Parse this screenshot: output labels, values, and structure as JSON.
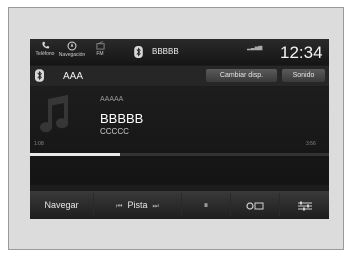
{
  "status_bar": {
    "phone_label": "Teléfono",
    "navigation_label": "Navegación",
    "radio_label": "FM",
    "device_name": "BBBBB",
    "clock": "12:34"
  },
  "header": {
    "source_title": "AAA",
    "change_device_label": "Cambiar disp.",
    "sound_label": "Sonido"
  },
  "now_playing": {
    "artist": "AAAAA",
    "track": "BBBBB",
    "album": "CCCCC",
    "progress": 0.3
  },
  "bottom_bar": {
    "navigate_label": "Navegar",
    "track_label": "Pista",
    "prev_symbol": "⏮",
    "next_symbol": "⏭",
    "pause_symbol": "⏸"
  },
  "colors": {
    "screen_bg": "#1c1c1c",
    "accent_text": "#ffffff",
    "progress_fill": "#e8e8e8"
  }
}
